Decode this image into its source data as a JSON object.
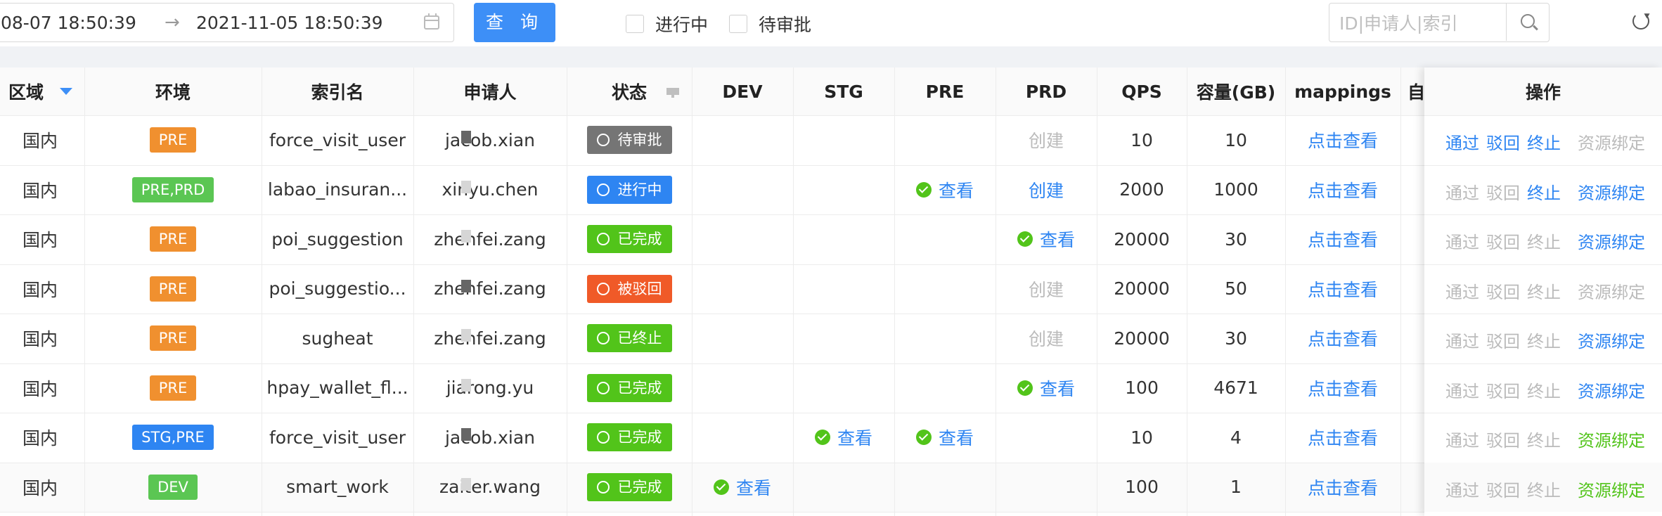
{
  "toolbar": {
    "date_start": "08-07 18:50:39",
    "date_arrow": "→",
    "date_end": "2021-11-05 18:50:39",
    "query_label": "查 询",
    "chk_running": "进行中",
    "chk_pending": "待审批",
    "search_placeholder": "ID|申请人|索引"
  },
  "columns": [
    "区域",
    "环境",
    "索引名",
    "申请人",
    "状态",
    "DEV",
    "STG",
    "PRE",
    "PRD",
    "QPS",
    "容量(GB)",
    "mappings",
    "自",
    "操作"
  ],
  "rows": [
    {
      "region": "国内",
      "env": "PRE",
      "env_color": "#f0902f",
      "index": "force_visit_user",
      "applicant": "jacob.xian",
      "status": "待审批",
      "status_color": "#757575",
      "status_icon": "clock-icon",
      "dev": "",
      "stg": "",
      "pre": "",
      "prd": "创建",
      "prd_style": "muted",
      "qps": "10",
      "capacity": "10",
      "mappings": "点击查看",
      "ops": [
        "通过",
        "驳回",
        "终止",
        "资源绑定"
      ],
      "ops_style": [
        "link",
        "link",
        "link",
        "muted"
      ]
    },
    {
      "region": "国内",
      "env": "PRE,PRD",
      "env_color": "#5bc653",
      "index": "labao_insuran...",
      "applicant": "xinyu.chen",
      "status": "进行中",
      "status_color": "#2e85f2",
      "status_icon": "sync-icon",
      "dev": "",
      "stg": "",
      "pre": "查看",
      "prd": "创建",
      "prd_style": "link",
      "qps": "2000",
      "capacity": "1000",
      "mappings": "点击查看",
      "ops": [
        "通过",
        "驳回",
        "终止",
        "资源绑定"
      ],
      "ops_style": [
        "muted",
        "muted",
        "link",
        "link"
      ]
    },
    {
      "region": "国内",
      "env": "PRE",
      "env_color": "#f0902f",
      "index": "poi_suggestion",
      "applicant": "zhenfei.zang",
      "status": "已完成",
      "status_color": "#52c41a",
      "status_icon": "check-circle-icon",
      "dev": "",
      "stg": "",
      "pre": "",
      "prd": "查看",
      "prd_style": "check",
      "qps": "20000",
      "capacity": "30",
      "mappings": "点击查看",
      "ops": [
        "通过",
        "驳回",
        "终止",
        "资源绑定"
      ],
      "ops_style": [
        "muted",
        "muted",
        "muted",
        "link"
      ]
    },
    {
      "region": "国内",
      "env": "PRE",
      "env_color": "#f0902f",
      "index": "poi_suggestio...",
      "applicant": "zhenfei.zang",
      "status": "被驳回",
      "status_color": "#f05a28",
      "status_icon": "minus-circle-icon",
      "dev": "",
      "stg": "",
      "pre": "",
      "prd": "创建",
      "prd_style": "muted",
      "qps": "20000",
      "capacity": "50",
      "mappings": "点击查看",
      "ops": [
        "通过",
        "驳回",
        "终止",
        "资源绑定"
      ],
      "ops_style": [
        "muted",
        "muted",
        "muted",
        "muted"
      ]
    },
    {
      "region": "国内",
      "env": "PRE",
      "env_color": "#f0902f",
      "index": "sugheat",
      "applicant": "zhenfei.zang",
      "status": "已终止",
      "status_color": "#52c41a",
      "status_icon": "check-circle-icon",
      "dev": "",
      "stg": "",
      "pre": "",
      "prd": "创建",
      "prd_style": "muted",
      "qps": "20000",
      "capacity": "30",
      "mappings": "点击查看",
      "ops": [
        "通过",
        "驳回",
        "终止",
        "资源绑定"
      ],
      "ops_style": [
        "muted",
        "muted",
        "muted",
        "link"
      ]
    },
    {
      "region": "国内",
      "env": "PRE",
      "env_color": "#f0902f",
      "index": "hpay_wallet_fl...",
      "applicant": "jiarong.yu",
      "status": "已完成",
      "status_color": "#52c41a",
      "status_icon": "check-circle-icon",
      "dev": "",
      "stg": "",
      "pre": "",
      "prd": "查看",
      "prd_style": "check",
      "qps": "100",
      "capacity": "4671",
      "mappings": "点击查看",
      "ops": [
        "通过",
        "驳回",
        "终止",
        "资源绑定"
      ],
      "ops_style": [
        "muted",
        "muted",
        "muted",
        "link"
      ]
    },
    {
      "region": "国内",
      "env": "STG,PRE",
      "env_color": "#2e85f2",
      "index": "force_visit_user",
      "applicant": "jacob.xian",
      "status": "已完成",
      "status_color": "#52c41a",
      "status_icon": "check-circle-icon",
      "dev": "",
      "stg": "查看",
      "pre": "查看",
      "prd": "",
      "prd_style": "",
      "qps": "10",
      "capacity": "4",
      "mappings": "点击查看",
      "ops": [
        "通过",
        "驳回",
        "终止",
        "资源绑定"
      ],
      "ops_style": [
        "muted",
        "muted",
        "muted",
        "green"
      ]
    },
    {
      "region": "国内",
      "env": "DEV",
      "env_color": "#5bc653",
      "index": "smart_work",
      "applicant": "zaiter.wang",
      "status": "已完成",
      "status_color": "#52c41a",
      "status_icon": "check-circle-icon",
      "dev": "查看",
      "stg": "",
      "pre": "",
      "prd": "",
      "prd_style": "",
      "qps": "100",
      "capacity": "1",
      "mappings": "点击查看",
      "ops": [
        "通过",
        "驳回",
        "终止",
        "资源绑定"
      ],
      "ops_style": [
        "muted",
        "muted",
        "muted",
        "green"
      ]
    }
  ]
}
